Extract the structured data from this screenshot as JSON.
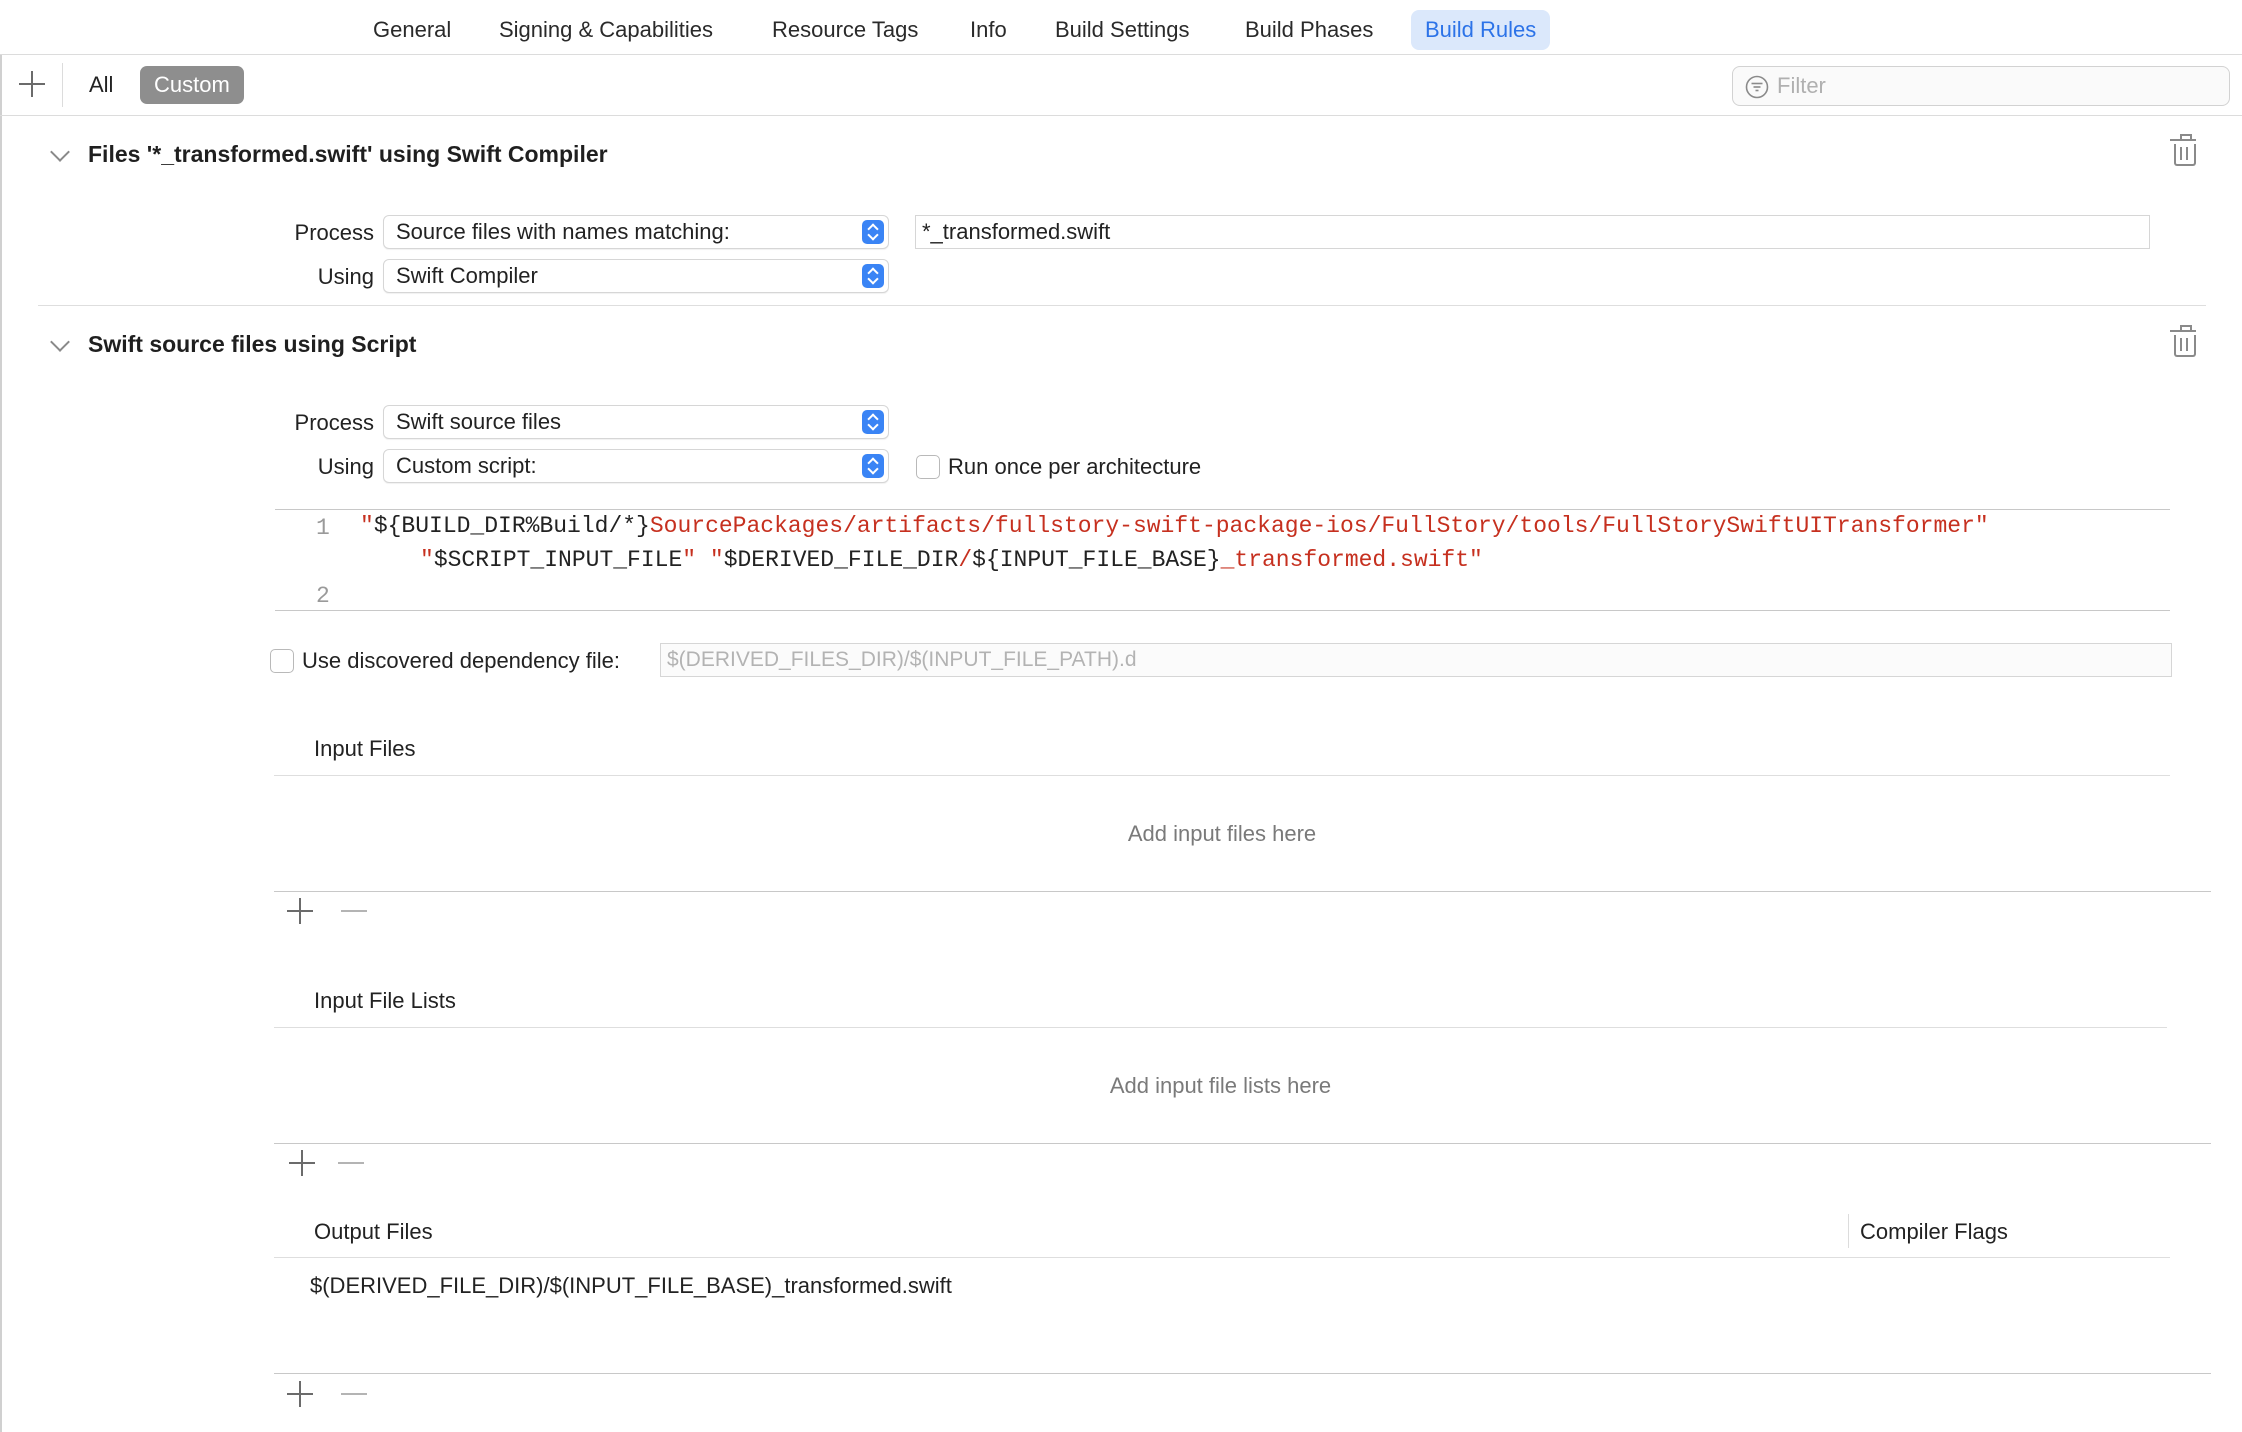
{
  "tabs": [
    {
      "label": "General"
    },
    {
      "label": "Signing & Capabilities"
    },
    {
      "label": "Resource Tags"
    },
    {
      "label": "Info"
    },
    {
      "label": "Build Settings"
    },
    {
      "label": "Build Phases"
    },
    {
      "label": "Build Rules"
    }
  ],
  "active_tab": "Build Rules",
  "toolbar": {
    "all_label": "All",
    "custom_label": "Custom",
    "filter_placeholder": "Filter"
  },
  "rule1": {
    "title": "Files '*_transformed.swift' using Swift Compiler",
    "process_label": "Process",
    "process_value": "Source files with names matching:",
    "pattern_value": "*_transformed.swift",
    "using_label": "Using",
    "using_value": "Swift Compiler"
  },
  "rule2": {
    "title": "Swift source files using Script",
    "process_label": "Process",
    "process_value": "Swift source files",
    "using_label": "Using",
    "using_value": "Custom script:",
    "run_once_label": "Run once per architecture",
    "script": {
      "line1_number": "1",
      "line1_q1": "\"",
      "line1_a": "${BUILD_DIR%Build/*}",
      "line1_b": "SourcePackages/artifacts/fullstory-swift-package-ios/FullStory/tools/FullStorySwiftUITransformer\"",
      "line1c_q1": "\"",
      "line1c_a": "$SCRIPT_INPUT_FILE",
      "line1c_q2": "\" \"",
      "line1c_b": "$DERIVED_FILE_DIR",
      "line1c_c": "/",
      "line1c_d": "${INPUT_FILE_BASE}",
      "line1c_e": "_transformed.swift\"",
      "line2_number": "2"
    },
    "dependency_label": "Use discovered dependency file:",
    "dependency_placeholder": "$(DERIVED_FILES_DIR)/$(INPUT_FILE_PATH).d",
    "input_files_header": "Input Files",
    "input_files_placeholder": "Add input files here",
    "input_file_lists_header": "Input File Lists",
    "input_file_lists_placeholder": "Add input file lists here",
    "output_files_header": "Output Files",
    "compiler_flags_header": "Compiler Flags",
    "output_files": [
      {
        "path": "$(DERIVED_FILE_DIR)/$(INPUT_FILE_BASE)_transformed.swift",
        "flags": ""
      }
    ]
  },
  "colors": {
    "accent": "#2c73e8",
    "active_tab_bg": "#dbe8fb",
    "string": "#c6301f",
    "stepper": "#3a84f5"
  }
}
